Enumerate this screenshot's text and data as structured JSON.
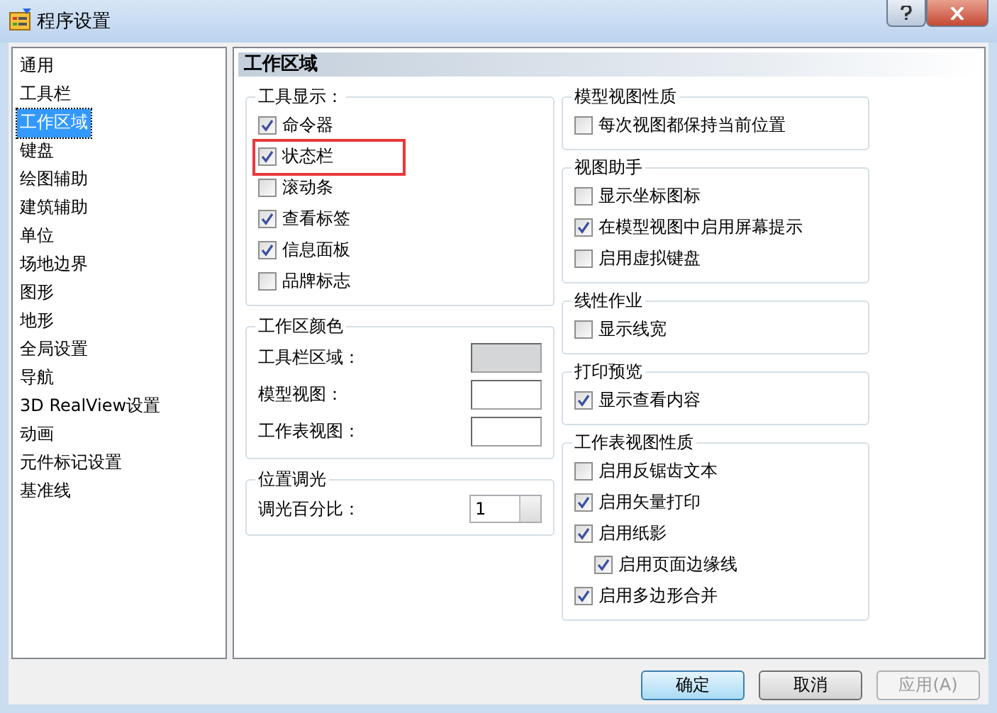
{
  "window": {
    "title": "程序设置"
  },
  "sidebar": {
    "items": [
      {
        "label": "通用",
        "selected": false
      },
      {
        "label": "工具栏",
        "selected": false
      },
      {
        "label": "工作区域",
        "selected": true
      },
      {
        "label": "键盘",
        "selected": false
      },
      {
        "label": "绘图辅助",
        "selected": false
      },
      {
        "label": "建筑辅助",
        "selected": false
      },
      {
        "label": "单位",
        "selected": false
      },
      {
        "label": "场地边界",
        "selected": false
      },
      {
        "label": "图形",
        "selected": false
      },
      {
        "label": "地形",
        "selected": false
      },
      {
        "label": "全局设置",
        "selected": false
      },
      {
        "label": "导航",
        "selected": false
      },
      {
        "label": "3D RealView设置",
        "selected": false
      },
      {
        "label": "动画",
        "selected": false
      },
      {
        "label": "元件标记设置",
        "selected": false
      },
      {
        "label": "基准线",
        "selected": false
      }
    ]
  },
  "panel": {
    "title": "工作区域",
    "left_groups": [
      {
        "title": "工具显示：",
        "kind": "checks",
        "items": [
          {
            "label": "命令器",
            "checked": true,
            "highlighted": false
          },
          {
            "label": "状态栏",
            "checked": true,
            "highlighted": true
          },
          {
            "label": "滚动条",
            "checked": false,
            "highlighted": false
          },
          {
            "label": "查看标签",
            "checked": true,
            "highlighted": false
          },
          {
            "label": "信息面板",
            "checked": true,
            "highlighted": false
          },
          {
            "label": "品牌标志",
            "checked": false,
            "highlighted": false
          }
        ]
      },
      {
        "title": "工作区颜色",
        "kind": "colors",
        "items": [
          {
            "label": "工具栏区域：",
            "color": "#d4d6d8"
          },
          {
            "label": "模型视图：",
            "color": "#ffffff"
          },
          {
            "label": "工作表视图：",
            "color": "#ffffff"
          }
        ]
      },
      {
        "title": "位置调光",
        "kind": "spinner",
        "items": [
          {
            "label": "调光百分比：",
            "value": "1"
          }
        ]
      }
    ],
    "right_groups": [
      {
        "title": "模型视图性质",
        "kind": "checks",
        "items": [
          {
            "label": "每次视图都保持当前位置",
            "checked": false
          }
        ]
      },
      {
        "title": "视图助手",
        "kind": "checks",
        "items": [
          {
            "label": "显示坐标图标",
            "checked": false
          },
          {
            "label": "在模型视图中启用屏幕提示",
            "checked": true
          },
          {
            "label": "启用虚拟键盘",
            "checked": false
          }
        ]
      },
      {
        "title": "线性作业",
        "kind": "checks",
        "items": [
          {
            "label": "显示线宽",
            "checked": false
          }
        ]
      },
      {
        "title": "打印预览",
        "kind": "checks",
        "items": [
          {
            "label": "显示查看内容",
            "checked": true
          }
        ]
      },
      {
        "title": "工作表视图性质",
        "kind": "checks",
        "items": [
          {
            "label": "启用反锯齿文本",
            "checked": false
          },
          {
            "label": "启用矢量打印",
            "checked": true
          },
          {
            "label": "启用纸影",
            "checked": true,
            "children": [
              {
                "label": "启用页面边缘线",
                "checked": true
              }
            ]
          },
          {
            "label": "启用多边形合并",
            "checked": true
          }
        ]
      }
    ]
  },
  "buttons": [
    {
      "label": "确定",
      "default": true,
      "disabled": false
    },
    {
      "label": "取消",
      "default": false,
      "disabled": false
    },
    {
      "label": "应用(A)",
      "default": false,
      "disabled": true
    }
  ]
}
